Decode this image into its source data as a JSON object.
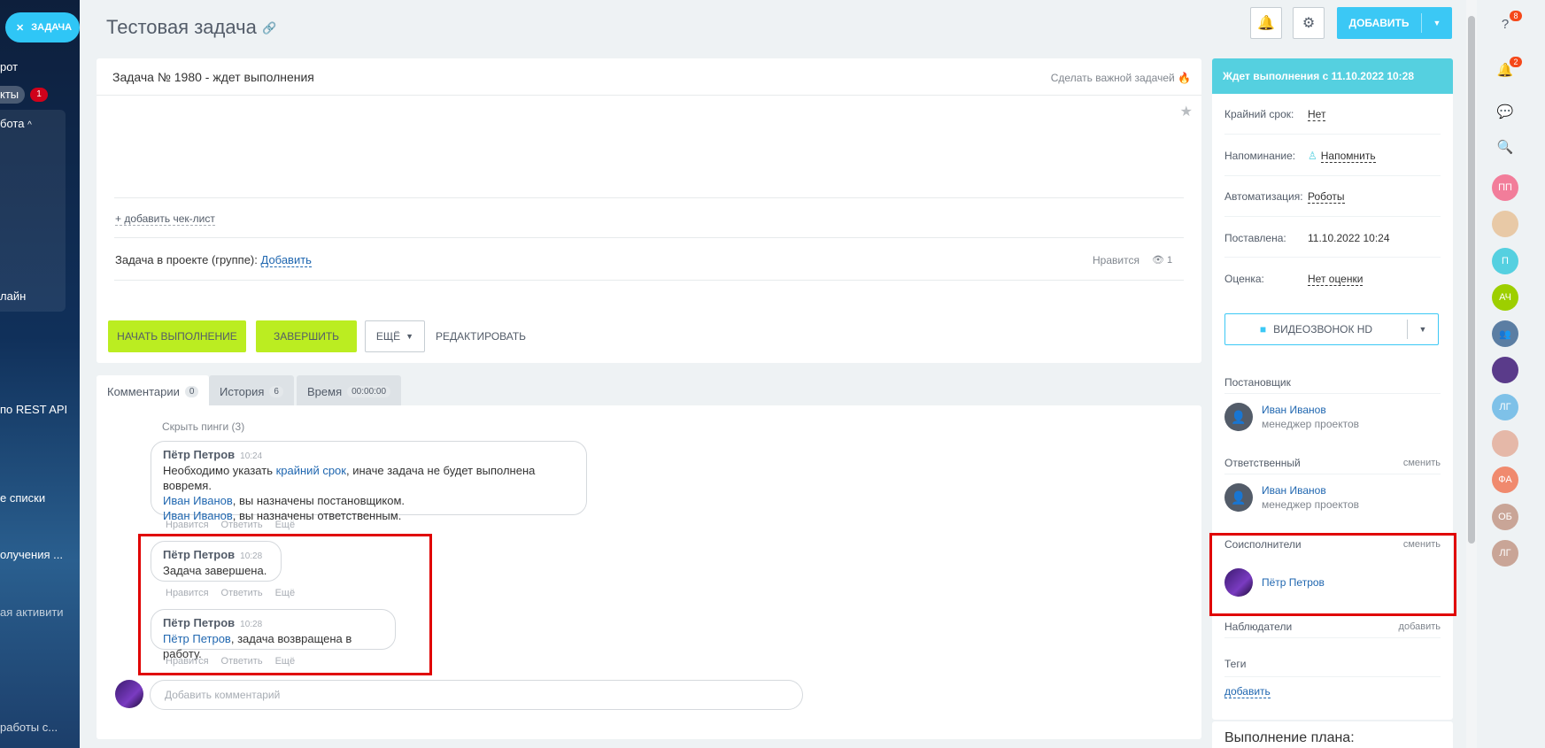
{
  "sidebar": {
    "task_chip": "ЗАДАЧА",
    "items": [
      "рот",
      "кты",
      "бота",
      "лайн",
      "по REST API",
      "е списки",
      "олучения ...",
      "ая активити",
      "работы с..."
    ],
    "badge": "1"
  },
  "header": {
    "title": "Тестовая задача",
    "add_label": "ДОБАВИТЬ"
  },
  "task": {
    "heading": "Задача № 1980 - ждет выполнения",
    "make_important": "Сделать важной задачей",
    "add_checklist": "+ добавить чек-лист",
    "project_label": "Задача в проекте (группе):",
    "project_add": "Добавить",
    "like": "Нравится",
    "views": "1",
    "start_button": "НАЧАТЬ ВЫПОЛНЕНИЕ",
    "finish_button": "ЗАВЕРШИТЬ",
    "more_button": "ЕЩЁ",
    "edit_button": "РЕДАКТИРОВАТЬ"
  },
  "tabs": [
    {
      "label": "Комментарии",
      "count": "0"
    },
    {
      "label": "История",
      "count": "6"
    },
    {
      "label": "Время",
      "count": "00:00:00"
    }
  ],
  "comments": {
    "hide_pings": "Скрыть пинги (3)",
    "actions": [
      "Нравится",
      "Ответить",
      "Ещё"
    ],
    "items": [
      {
        "author": "Пётр Петров",
        "time": "10:24",
        "line1_pre": "Необходимо указать ",
        "line1_link": "крайний срок",
        "line1_post": ", иначе задача не будет выполнена вовремя.",
        "line2_link": "Иван Иванов",
        "line2_post": ", вы назначены постановщиком.",
        "line3_link": "Иван Иванов",
        "line3_post": ", вы назначены ответственным."
      },
      {
        "author": "Пётр Петров",
        "time": "10:28",
        "text": "Задача завершена."
      },
      {
        "author": "Пётр Петров",
        "time": "10:28",
        "link": "Пётр Петров",
        "text": ", задача возвращена в работу."
      }
    ],
    "input_placeholder": "Добавить комментарий"
  },
  "side": {
    "status": "Ждет выполнения с 11.10.2022 10:28",
    "rows": [
      {
        "k": "Крайний срок:",
        "v": "Нет"
      },
      {
        "k": "Напоминание:",
        "v": "Напомнить"
      },
      {
        "k": "Автоматизация:",
        "v": "Роботы"
      },
      {
        "k": "Поставлена:",
        "v": "11.10.2022 10:24"
      },
      {
        "k": "Оценка:",
        "v": "Нет оценки"
      }
    ],
    "video_call": "ВИДЕОЗВОНОК HD",
    "creator_title": "Постановщик",
    "creator_name": "Иван Иванов",
    "creator_role": "менеджер проектов",
    "responsible_title": "Ответственный",
    "responsible_change": "сменить",
    "responsible_name": "Иван Иванов",
    "responsible_role": "менеджер проектов",
    "accomplices_title": "Соисполнители",
    "accomplices_change": "сменить",
    "accomplice_name": "Пётр Петров",
    "observers_title": "Наблюдатели",
    "observers_add": "добавить",
    "tags_title": "Теги",
    "tags_add": "добавить",
    "plan_title": "Выполнение плана:"
  },
  "rail": {
    "help_badge": "8",
    "notify_badge": "2",
    "avatars": [
      {
        "initials": "ПП",
        "color": "#f27d9a"
      },
      {
        "initials": "",
        "color": "#e8c9a6"
      },
      {
        "initials": "П",
        "color": "#55d0e0"
      },
      {
        "initials": "АЧ",
        "color": "#9dcf00"
      },
      {
        "initials": "",
        "color": "#5b7ea3"
      },
      {
        "initials": "",
        "color": "#5a3b8a"
      },
      {
        "initials": "ЛГ",
        "color": "#7ec1e8"
      },
      {
        "initials": "",
        "color": "#e5b8a8"
      },
      {
        "initials": "ФА",
        "color": "#f08a6e"
      },
      {
        "initials": "ОБ",
        "color": "#c9a597"
      },
      {
        "initials": "ЛГ",
        "color": "#c9a597"
      }
    ]
  },
  "colors": {
    "accent": "#3bc8f5",
    "green_button": "#bbed21",
    "status_header": "#55d0e0",
    "highlight": "#e00000"
  }
}
